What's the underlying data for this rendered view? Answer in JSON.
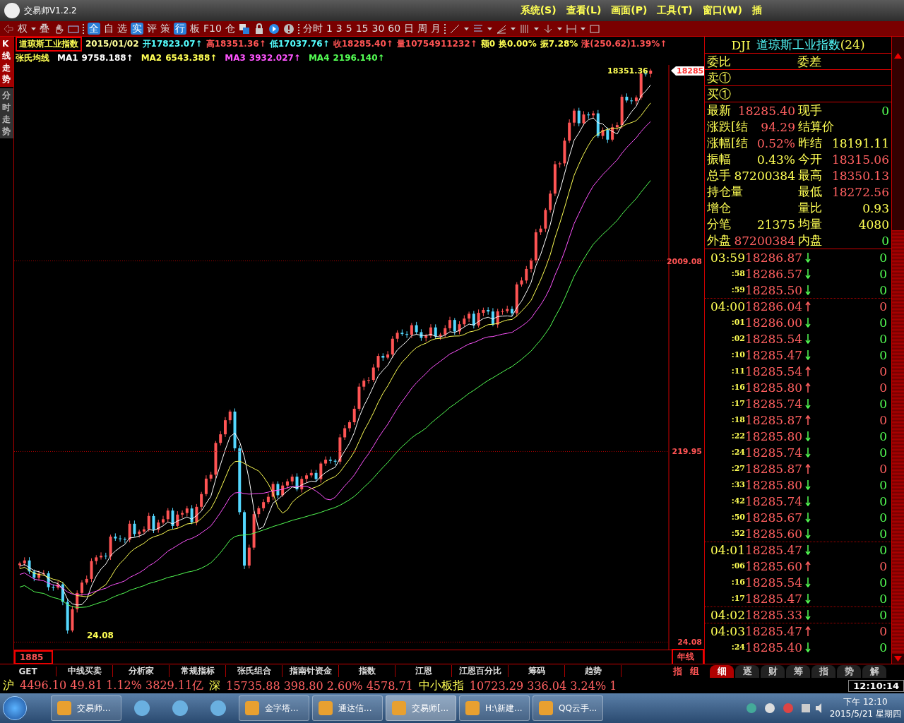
{
  "window": {
    "title": "交易师V1.2.2"
  },
  "menu": [
    {
      "label": "系统(S)"
    },
    {
      "label": "查看(L)"
    },
    {
      "label": "画面(P)"
    },
    {
      "label": "工具(T)"
    },
    {
      "label": "窗口(W)"
    },
    {
      "label": "插"
    }
  ],
  "toolbar": {
    "left_labels": [
      "权",
      "叠"
    ],
    "nav_labels": [
      {
        "label": "全",
        "kind": "badge"
      },
      {
        "label": "自",
        "kind": "text"
      },
      {
        "label": "选",
        "kind": "text"
      },
      {
        "label": "实",
        "kind": "badge"
      },
      {
        "label": "评",
        "kind": "text"
      },
      {
        "label": "策",
        "kind": "text"
      },
      {
        "label": "行",
        "kind": "badge"
      },
      {
        "label": "板",
        "kind": "text"
      },
      {
        "label": "F10",
        "kind": "text"
      },
      {
        "label": "仓",
        "kind": "text"
      }
    ],
    "period_labels": [
      "分时",
      "1",
      "3",
      "5",
      "15",
      "30",
      "60",
      "日",
      "周",
      "月"
    ]
  },
  "side_tabs": [
    {
      "label": "K线走势",
      "selected": true
    },
    {
      "label": "分时走势",
      "selected": false
    }
  ],
  "quote_line": {
    "title": "道琼斯工业指数",
    "items": [
      {
        "text": "2015/01/02",
        "color": "#ffff9a"
      },
      {
        "text": "开17823.07↑",
        "color": "#54ffff"
      },
      {
        "text": "高18351.36↑",
        "color": "#ff5454"
      },
      {
        "text": "低17037.76↑",
        "color": "#54ffff"
      },
      {
        "text": "收18285.40↑",
        "color": "#ff5454"
      },
      {
        "text": "量10754911232↑",
        "color": "#ff5454"
      },
      {
        "text": "额0",
        "color": "#ffff54"
      },
      {
        "text": "换0.00%",
        "color": "#ffff54"
      },
      {
        "text": "振7.28%",
        "color": "#ffff54"
      },
      {
        "text": "涨(250.62)1.39%↑",
        "color": "#ff5454"
      }
    ]
  },
  "ma_line": {
    "name": "张氏均线",
    "items": [
      {
        "label": "MA1",
        "value": "9758.188↑",
        "color": "#ffffff"
      },
      {
        "label": "MA2",
        "value": "6543.388↑",
        "color": "#ffff54"
      },
      {
        "label": "MA3",
        "value": "3932.027↑",
        "color": "#ff54ff"
      },
      {
        "label": "MA4",
        "value": "2196.140↑",
        "color": "#54ff54"
      }
    ]
  },
  "chart": {
    "high_label": "18351.36",
    "low_label": "24.08",
    "price_axis": [
      "18285",
      "2009.08",
      "219.95",
      "24.08"
    ],
    "start_year": "1885",
    "period": "年线"
  },
  "bottom_tabs": [
    {
      "label": "GET"
    },
    {
      "label": "中线买卖"
    },
    {
      "label": "分析家"
    },
    {
      "label": "常规指标"
    },
    {
      "label": "张氏组合"
    },
    {
      "label": "指南针资金"
    },
    {
      "label": "指数"
    },
    {
      "label": "江恩"
    },
    {
      "label": "江恩百分比"
    },
    {
      "label": "筹码"
    },
    {
      "label": "趋势"
    }
  ],
  "bottom_small_tabs": [
    "指",
    "组"
  ],
  "panel": {
    "code": "DJI",
    "name": "道琼斯工业指数",
    "count": "(24)",
    "order_rows": [
      {
        "label": "委比",
        "label_2": "委差"
      },
      {
        "label": "卖①"
      },
      {
        "label": "买①"
      }
    ],
    "stats": [
      {
        "label": "最新",
        "value": "18285.40",
        "color": "#ff6060"
      },
      {
        "label": "现手",
        "value": "0",
        "color": "#54ff54"
      },
      {
        "label": "涨跌[结",
        "value": "94.29",
        "color": "#ff6060"
      },
      {
        "label": "结算价"
      },
      {
        "label": "涨幅[结",
        "value": "0.52%",
        "color": "#ff6060"
      },
      {
        "label": "昨结",
        "value": "18191.11",
        "color": "#ffff54"
      },
      {
        "label": "振幅",
        "value": "0.43%",
        "color": "#ffff54"
      },
      {
        "label": "今开",
        "value": "18315.06",
        "color": "#ff6060"
      },
      {
        "label": "总手",
        "value": "87200384",
        "color": "#ffff54"
      },
      {
        "label": "最高",
        "value": "18350.13",
        "color": "#ff6060"
      },
      {
        "label": "持仓量"
      },
      {
        "label": "最低",
        "value": "18272.56",
        "color": "#ff6060"
      },
      {
        "label": "增仓"
      },
      {
        "label": "量比",
        "value": "0.93",
        "color": "#ffff54"
      },
      {
        "label": "分笔",
        "value": "21375",
        "color": "#ffff54"
      },
      {
        "label": "均量",
        "value": "4080",
        "color": "#ffff54"
      },
      {
        "label": "外盘",
        "value": "87200384",
        "color": "#ff6060"
      },
      {
        "label": "内盘",
        "value": "0",
        "color": "#54ff54"
      }
    ],
    "ticks": [
      {
        "time": "03:59",
        "kind": "minute",
        "price": "18286.87",
        "up": false,
        "volume": "0"
      },
      {
        "time": ":58",
        "kind": "second",
        "price": "18286.57",
        "up": false,
        "volume": "0"
      },
      {
        "time": ":59",
        "kind": "second",
        "price": "18285.50",
        "up": false,
        "volume": "0"
      },
      {
        "time": "04:00",
        "kind": "minute",
        "price": "18286.04",
        "up": true,
        "volume": "0"
      },
      {
        "time": ":01",
        "kind": "second",
        "price": "18286.00",
        "up": false,
        "volume": "0"
      },
      {
        "time": ":02",
        "kind": "second",
        "price": "18285.54",
        "up": false,
        "volume": "0"
      },
      {
        "time": ":10",
        "kind": "second",
        "price": "18285.47",
        "up": false,
        "volume": "0"
      },
      {
        "time": ":11",
        "kind": "second",
        "price": "18285.54",
        "up": true,
        "volume": "0"
      },
      {
        "time": ":16",
        "kind": "second",
        "price": "18285.80",
        "up": true,
        "volume": "0"
      },
      {
        "time": ":17",
        "kind": "second",
        "price": "18285.74",
        "up": false,
        "volume": "0"
      },
      {
        "time": ":18",
        "kind": "second",
        "price": "18285.87",
        "up": true,
        "volume": "0"
      },
      {
        "time": ":22",
        "kind": "second",
        "price": "18285.80",
        "up": false,
        "volume": "0"
      },
      {
        "time": ":24",
        "kind": "second",
        "price": "18285.74",
        "up": false,
        "volume": "0"
      },
      {
        "time": ":27",
        "kind": "second",
        "price": "18285.87",
        "up": true,
        "volume": "0"
      },
      {
        "time": ":33",
        "kind": "second",
        "price": "18285.80",
        "up": false,
        "volume": "0"
      },
      {
        "time": ":42",
        "kind": "second",
        "price": "18285.74",
        "up": false,
        "volume": "0"
      },
      {
        "time": ":50",
        "kind": "second",
        "price": "18285.67",
        "up": false,
        "volume": "0"
      },
      {
        "time": ":52",
        "kind": "second",
        "price": "18285.60",
        "up": false,
        "volume": "0"
      },
      {
        "time": "04:01",
        "kind": "minute",
        "price": "18285.47",
        "up": false,
        "volume": "0"
      },
      {
        "time": ":06",
        "kind": "second",
        "price": "18285.60",
        "up": true,
        "volume": "0"
      },
      {
        "time": ":16",
        "kind": "second",
        "price": "18285.54",
        "up": false,
        "volume": "0"
      },
      {
        "time": ":17",
        "kind": "second",
        "price": "18285.47",
        "up": false,
        "volume": "0"
      },
      {
        "time": "04:02",
        "kind": "minute",
        "price": "18285.33",
        "up": false,
        "volume": "0"
      },
      {
        "time": "04:03",
        "kind": "minute",
        "price": "18285.47",
        "up": true,
        "volume": "0"
      },
      {
        "time": ":24",
        "kind": "second",
        "price": "18285.40",
        "up": false,
        "volume": "0"
      }
    ],
    "tabs": [
      {
        "label": "细",
        "selected": true
      },
      {
        "label": "逐",
        "selected": false
      },
      {
        "label": "财",
        "selected": false
      },
      {
        "label": "筹",
        "selected": false
      },
      {
        "label": "指",
        "selected": false
      },
      {
        "label": "势",
        "selected": false
      },
      {
        "label": "解",
        "selected": false
      }
    ]
  },
  "ticker": [
    {
      "name": "沪",
      "values": "4496.10 49.81 1.12% 3829.11亿"
    },
    {
      "name": "深",
      "values": "15735.88 398.80 2.60% 4578.71"
    },
    {
      "name": "中小板指",
      "values": "10723.29 336.04 3.24% 1"
    }
  ],
  "clock": "12:10:14",
  "taskbar": {
    "items": [
      {
        "kind": "app",
        "label": "交易师...",
        "active": false
      },
      {
        "kind": "pinned"
      },
      {
        "kind": "pinned"
      },
      {
        "kind": "pinned"
      },
      {
        "kind": "app",
        "label": "金字塔...",
        "active": false
      },
      {
        "kind": "app",
        "label": "通达信...",
        "active": false
      },
      {
        "kind": "app",
        "label": "交易师[...",
        "active": true
      },
      {
        "kind": "app",
        "label": "H:\\新建...",
        "active": false
      },
      {
        "kind": "app",
        "label": "QQ云手...",
        "active": false
      }
    ],
    "time": "下午 12:10",
    "date": "2015/5/21 星期四"
  }
}
